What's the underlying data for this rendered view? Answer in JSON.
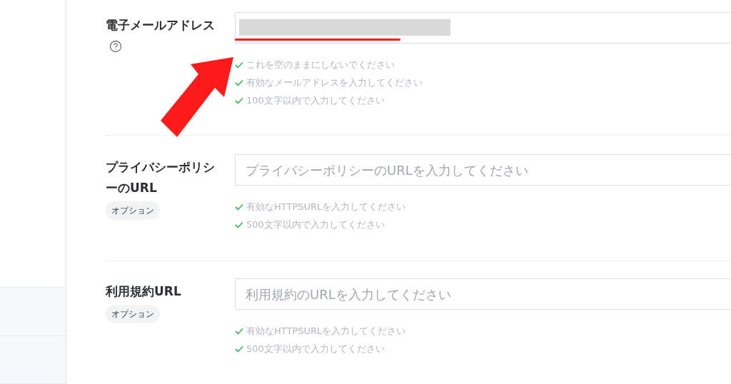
{
  "sidebar": {
    "rows": [
      {
        "kind": "plain"
      },
      {
        "kind": "plain"
      },
      {
        "kind": "shaded"
      },
      {
        "kind": "shaded"
      }
    ]
  },
  "fields": [
    {
      "label": "電子メールアドレス",
      "help_icon": true,
      "redacted": true,
      "rules": [
        {
          "text": "これを空のままにしないでください",
          "checked": true
        },
        {
          "text": "有効なメールアドレスを入力してください",
          "checked": true
        },
        {
          "text": "100文字以内で入力してください",
          "checked": true
        }
      ]
    },
    {
      "label": "プライバシーポリシーのURL",
      "badge": "オプション",
      "placeholder": "プライバシーポリシーのURLを入力してください",
      "rules": [
        {
          "text": "有効なHTTPSURLを入力してください",
          "checked": true
        },
        {
          "text": "500文字以内で入力してください",
          "checked": true
        }
      ]
    },
    {
      "label": "利用規約URL",
      "badge": "オプション",
      "placeholder": "利用規約のURLを入力してください",
      "rules": [
        {
          "text": "有効なHTTPSURLを入力してください",
          "checked": true
        },
        {
          "text": "500文字以内で入力してください",
          "checked": true
        }
      ]
    }
  ]
}
